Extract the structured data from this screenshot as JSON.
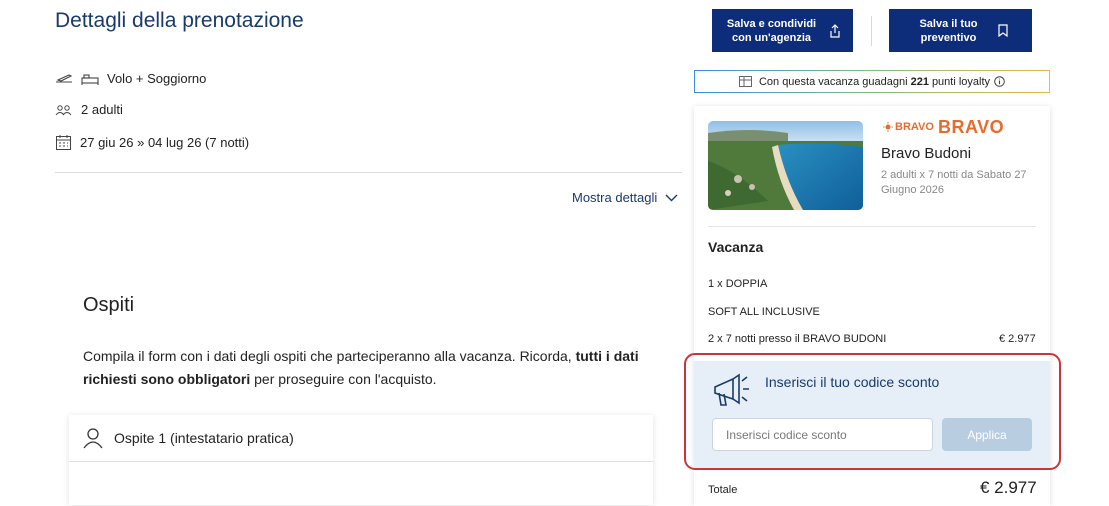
{
  "page": {
    "title": "Dettagli della prenotazione"
  },
  "details": {
    "package": "Volo + Soggiorno",
    "guests": "2 adulti",
    "dates": "27 giu 26 » 04 lug 26 (7 notti)",
    "show_details": "Mostra dettagli"
  },
  "ospiti": {
    "title": "Ospiti",
    "desc_1": "Compila il form con i dati degli ospiti che parteciperanno alla vacanza. Ricorda, ",
    "desc_bold": "tutti i dati richiesti sono obbligatori",
    "desc_2": " per proseguire con l'acquisto.",
    "guest_1": "Ospite 1 (intestatario pratica)"
  },
  "actions": {
    "share_label": "Salva e condividi con un'agenzia",
    "save_label": "Salva il tuo preventivo"
  },
  "loyalty": {
    "prefix": "Con questa vacanza guadagni",
    "points": "221",
    "suffix": "punti loyalty"
  },
  "summary": {
    "brand_small": "BRAVO",
    "brand_large": "BRAVO",
    "hotel_name": "Bravo Budoni",
    "hotel_sub": "2 adulti x 7 notti da Sabato 27 Giugno 2026",
    "section": "Vacanza",
    "room": "1 x DOPPIA",
    "board": "SOFT ALL INCLUSIVE",
    "stay_line": "2 x 7 notti presso il BRAVO BUDONI",
    "stay_price": "€ 2.977",
    "total_label": "Totale",
    "total_value": "€ 2.977"
  },
  "promo": {
    "title": "Inserisci il tuo codice sconto",
    "placeholder": "Inserisci codice sconto",
    "apply": "Applica"
  },
  "colors": {
    "primary": "#0d2c7a",
    "heading": "#1a3a6b",
    "brand": "#e86b2c",
    "highlight": "#c9353b",
    "promo_bg": "#e6eff7"
  }
}
